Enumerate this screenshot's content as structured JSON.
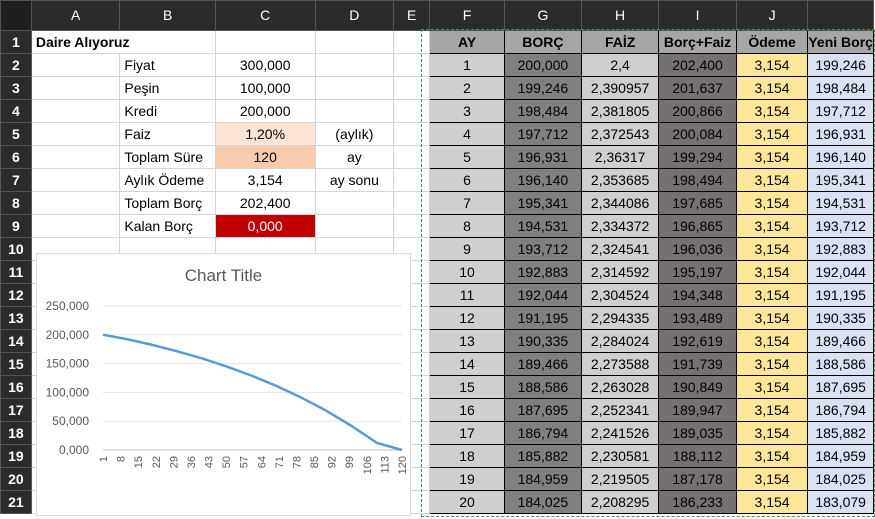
{
  "columns": [
    "A",
    "B",
    "C",
    "D",
    "E",
    "F",
    "G",
    "H",
    "I",
    "J"
  ],
  "rows": [
    "1",
    "2",
    "3",
    "4",
    "5",
    "6",
    "7",
    "8",
    "9",
    "10",
    "11",
    "12",
    "13",
    "14",
    "15",
    "16",
    "17",
    "18",
    "19",
    "20",
    "21"
  ],
  "sheet": {
    "title": "Daire Alıyoruz",
    "params": [
      {
        "label": "Fiyat",
        "value": "300,000",
        "unit": ""
      },
      {
        "label": "Peşin",
        "value": "100,000",
        "unit": ""
      },
      {
        "label": "Kredi",
        "value": "200,000",
        "unit": ""
      },
      {
        "label": "Faiz",
        "value": "1,20%",
        "unit": "(aylık)"
      },
      {
        "label": "Toplam Süre",
        "value": "120",
        "unit": "ay"
      },
      {
        "label": "Aylık Ödeme",
        "value": "3,154",
        "unit": "ay sonu"
      },
      {
        "label": "Toplam Borç",
        "value": "202,400",
        "unit": ""
      },
      {
        "label": "Kalan Borç",
        "value": "0,000",
        "unit": ""
      }
    ]
  },
  "schedule": {
    "headers": [
      "AY",
      "BORÇ",
      "FAİZ",
      "Borç+Faiz",
      "Ödeme",
      "Yeni Borç"
    ],
    "rows": [
      [
        "1",
        "200,000",
        "2,4",
        "202,400",
        "3,154",
        "199,246"
      ],
      [
        "2",
        "199,246",
        "2,390957",
        "201,637",
        "3,154",
        "198,484"
      ],
      [
        "3",
        "198,484",
        "2,381805",
        "200,866",
        "3,154",
        "197,712"
      ],
      [
        "4",
        "197,712",
        "2,372543",
        "200,084",
        "3,154",
        "196,931"
      ],
      [
        "5",
        "196,931",
        "2,36317",
        "199,294",
        "3,154",
        "196,140"
      ],
      [
        "6",
        "196,140",
        "2,353685",
        "198,494",
        "3,154",
        "195,341"
      ],
      [
        "7",
        "195,341",
        "2,344086",
        "197,685",
        "3,154",
        "194,531"
      ],
      [
        "8",
        "194,531",
        "2,334372",
        "196,865",
        "3,154",
        "193,712"
      ],
      [
        "9",
        "193,712",
        "2,324541",
        "196,036",
        "3,154",
        "192,883"
      ],
      [
        "10",
        "192,883",
        "2,314592",
        "195,197",
        "3,154",
        "192,044"
      ],
      [
        "11",
        "192,044",
        "2,304524",
        "194,348",
        "3,154",
        "191,195"
      ],
      [
        "12",
        "191,195",
        "2,294335",
        "193,489",
        "3,154",
        "190,335"
      ],
      [
        "13",
        "190,335",
        "2,284024",
        "192,619",
        "3,154",
        "189,466"
      ],
      [
        "14",
        "189,466",
        "2,273588",
        "191,739",
        "3,154",
        "188,586"
      ],
      [
        "15",
        "188,586",
        "2,263028",
        "190,849",
        "3,154",
        "187,695"
      ],
      [
        "16",
        "187,695",
        "2,252341",
        "189,947",
        "3,154",
        "186,794"
      ],
      [
        "17",
        "186,794",
        "2,241526",
        "189,035",
        "3,154",
        "185,882"
      ],
      [
        "18",
        "185,882",
        "2,230581",
        "188,112",
        "3,154",
        "184,959"
      ],
      [
        "19",
        "184,959",
        "2,219505",
        "187,178",
        "3,154",
        "184,025"
      ],
      [
        "20",
        "184,025",
        "2,208295",
        "186,233",
        "3,154",
        "183,079"
      ]
    ]
  },
  "chart_data": {
    "type": "line",
    "title": "Chart Title",
    "xlabel": "",
    "ylabel": "",
    "ylim": [
      0,
      250000
    ],
    "y_ticks": [
      "0,000",
      "50,000",
      "100,000",
      "150,000",
      "200,000",
      "250,000"
    ],
    "x_ticks": [
      "1",
      "8",
      "15",
      "22",
      "29",
      "36",
      "43",
      "50",
      "57",
      "64",
      "71",
      "78",
      "85",
      "92",
      "99",
      "106",
      "113",
      "120"
    ],
    "x_tick_values": [
      1,
      8,
      15,
      22,
      29,
      36,
      43,
      50,
      57,
      64,
      71,
      78,
      85,
      92,
      99,
      106,
      113,
      120
    ],
    "xlim": [
      1,
      120
    ],
    "grid": true,
    "legend": "none",
    "series": [
      {
        "color": "#5b9bd5",
        "x": [
          1,
          10,
          20,
          30,
          40,
          50,
          60,
          70,
          80,
          90,
          100,
          110,
          120
        ],
        "values": [
          200000,
          192883,
          183079,
          172000,
          159500,
          145300,
          129300,
          111200,
          90800,
          67800,
          41700,
          12400,
          0
        ]
      }
    ]
  },
  "colors": {
    "header_bg": "#2b2b2b",
    "accent_green": "#3a9a5a",
    "red_cell": "#c00000",
    "odeme": "#ffe699",
    "yeni_borc": "#d9e1f2"
  }
}
